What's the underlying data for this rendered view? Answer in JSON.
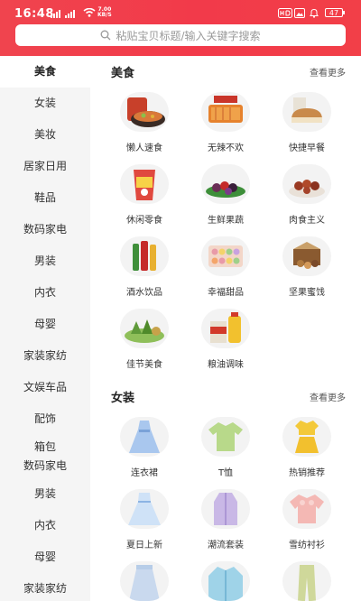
{
  "status": {
    "time": "16:48",
    "net_speed_value": "7.00",
    "net_speed_unit": "KB/S",
    "battery": "47"
  },
  "search": {
    "placeholder": "粘贴宝贝标题/输入关键字搜索"
  },
  "sidebar": {
    "items": [
      {
        "label": "美食"
      },
      {
        "label": "女装"
      },
      {
        "label": "美妆"
      },
      {
        "label": "居家日用"
      },
      {
        "label": "鞋品"
      },
      {
        "label": "数码家电"
      },
      {
        "label": "男装"
      },
      {
        "label": "内衣"
      },
      {
        "label": "母婴"
      },
      {
        "label": "家装家纺"
      },
      {
        "label": "文娱车品"
      },
      {
        "label": "配饰"
      },
      {
        "label": "箱包"
      },
      {
        "label": "数码家电"
      },
      {
        "label": "男装"
      },
      {
        "label": "内衣"
      },
      {
        "label": "母婴"
      },
      {
        "label": "家装家纺"
      }
    ]
  },
  "sections": [
    {
      "title": "美食",
      "more": "查看更多",
      "items": [
        {
          "label": "懒人速食",
          "icon": "instant-noodles-icon"
        },
        {
          "label": "无辣不欢",
          "icon": "spicy-snack-icon"
        },
        {
          "label": "快捷早餐",
          "icon": "bread-icon"
        },
        {
          "label": "休闲零食",
          "icon": "snack-bag-icon"
        },
        {
          "label": "生鲜果蔬",
          "icon": "fruit-icon"
        },
        {
          "label": "肉食主义",
          "icon": "meat-icon"
        },
        {
          "label": "酒水饮品",
          "icon": "drink-bottles-icon"
        },
        {
          "label": "幸福甜品",
          "icon": "macaron-box-icon"
        },
        {
          "label": "坚果蜜饯",
          "icon": "nuts-box-icon"
        },
        {
          "label": "佳节美食",
          "icon": "rice-dumplings-icon"
        },
        {
          "label": "粮油调味",
          "icon": "rice-oil-icon"
        }
      ]
    },
    {
      "title": "女装",
      "more": "查看更多",
      "items": [
        {
          "label": "连衣裙",
          "icon": "dress-icon"
        },
        {
          "label": "T恤",
          "icon": "tshirt-icon"
        },
        {
          "label": "热销推荐",
          "icon": "top-skirt-icon"
        },
        {
          "label": "夏日上新",
          "icon": "summer-dress-icon"
        },
        {
          "label": "潮流套装",
          "icon": "outfit-icon"
        },
        {
          "label": "雪纺衬衫",
          "icon": "chiffon-shirt-icon"
        },
        {
          "label": "",
          "icon": "skirt-icon"
        },
        {
          "label": "",
          "icon": "jacket-icon"
        },
        {
          "label": "",
          "icon": "pants-icon"
        }
      ]
    }
  ],
  "colors": {
    "brand": "#f23a4a",
    "sidebar_bg": "#f5f5f5",
    "accent_orange": "#f28a1e"
  }
}
